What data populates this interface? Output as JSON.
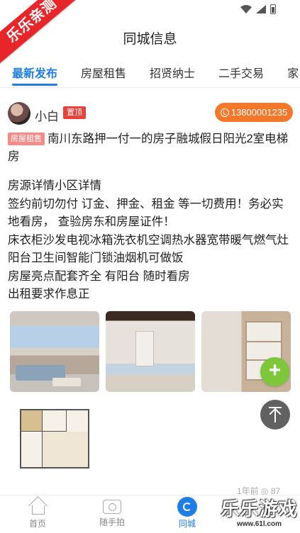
{
  "watermark": {
    "ribbon": "乐乐亲测",
    "logo": "乐乐游戏",
    "url": "www.61l.com"
  },
  "header": {
    "title": "同城信息"
  },
  "tabs": [
    {
      "label": "最新发布",
      "active": true
    },
    {
      "label": "房屋租售",
      "active": false
    },
    {
      "label": "招贤纳士",
      "active": false
    },
    {
      "label": "二手交易",
      "active": false
    },
    {
      "label": "家",
      "active": false
    }
  ],
  "post": {
    "username": "小白",
    "top_badge": "置顶",
    "phone": "13800001235",
    "category": "房屋租售",
    "title": "南川东路押一付一的房子融城假日阳光2室电梯房",
    "body": [
      "房源详情小区详情",
      "签约前切勿付 订金、押金、租金 等一切费用！务必实地看房， 查验房东和房屋证件！",
      "床衣柜沙发电视冰箱洗衣机空调热水器宽带暖气燃气灶阳台卫生间智能门锁油烟机可做饭",
      "房屋亮点配套齐全 有阳台 随时看房",
      "出租要求作息正"
    ],
    "images": [
      "living-room-photo",
      "hallway-photo",
      "cabinet-photo",
      "floor-plan"
    ],
    "meta": "1年前  ◎ 87"
  },
  "fab": {
    "add": "+",
    "top": "scroll-to-top"
  },
  "bottom_nav": [
    {
      "label": "首页",
      "icon": "home-icon",
      "active": false
    },
    {
      "label": "随手拍",
      "icon": "camera-icon",
      "active": false
    },
    {
      "label": "同城",
      "icon": "city-icon",
      "active": true
    }
  ],
  "colors": {
    "accent": "#1e7ee6",
    "phone_button": "#f5782a",
    "top_badge": "#e8403a",
    "category_badge": "#f58b88",
    "add_button": "#7ec63a",
    "ribbon": "#e8262a"
  }
}
